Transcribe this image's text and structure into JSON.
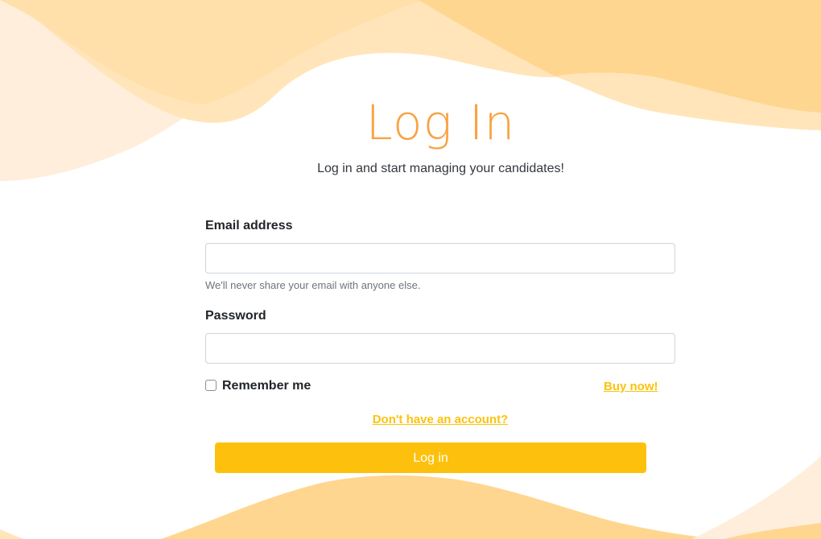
{
  "page": {
    "title": "Log In",
    "subtitle": "Log in and start managing your candidates!"
  },
  "form": {
    "email_label": "Email address",
    "email_value": "",
    "email_help": "We'll never share your email with anyone else.",
    "password_label": "Password",
    "password_value": "",
    "remember_label": "Remember me",
    "remember_checked": false,
    "buy_link": "Buy now!",
    "signup_link": "Don't have an account?",
    "submit_label": "Log in"
  },
  "colors": {
    "title": "#f8a344",
    "accent": "#fdc10d",
    "wave_dark": "#ffd690",
    "wave_light": "#ffe6bb"
  }
}
